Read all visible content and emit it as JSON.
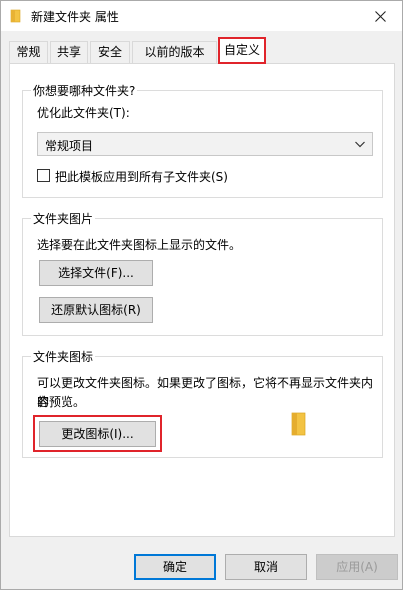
{
  "window": {
    "title": "新建文件夹 属性",
    "close_glyph": "✕"
  },
  "tabs": [
    {
      "label": "常规"
    },
    {
      "label": "共享"
    },
    {
      "label": "安全"
    },
    {
      "label": "以前的版本"
    },
    {
      "label": "自定义",
      "active": true
    }
  ],
  "folder_type": {
    "group_title": "你想要哪种文件夹?",
    "optimize_label": "优化此文件夹(T):",
    "selected": "常规项目",
    "apply_subfolders_label": "把此模板应用到所有子文件夹(S)",
    "apply_subfolders_checked": false
  },
  "folder_pictures": {
    "group_title": "文件夹图片",
    "description": "选择要在此文件夹图标上显示的文件。",
    "choose_file_label": "选择文件(F)...",
    "restore_default_label": "还原默认图标(R)"
  },
  "folder_icons": {
    "group_title": "文件夹图标",
    "description_line1": "可以更改文件夹图标。如果更改了图标，它将不再显示文件夹内容",
    "description_line2": "的预览。",
    "change_icon_label": "更改图标(I)..."
  },
  "footer": {
    "ok_label": "确定",
    "cancel_label": "取消",
    "apply_label": "应用(A)",
    "apply_disabled": true
  },
  "colors": {
    "highlight": "#e0242b",
    "folder_yellow": "#f3c343",
    "primary_border": "#0078d7"
  },
  "icons": {
    "title_icon": "folder-icon",
    "close_icon": "close-icon",
    "dropdown_icon": "chevron-down-icon",
    "preview_icon": "folder-icon"
  }
}
